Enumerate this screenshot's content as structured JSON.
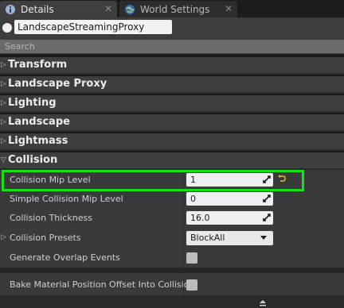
{
  "tabs": [
    {
      "label": "Details",
      "icon": "details-icon",
      "active": true
    },
    {
      "label": "World Settings",
      "icon": "globe-icon",
      "active": false
    }
  ],
  "actor": {
    "name": "LandscapeStreamingProxy"
  },
  "search": {
    "placeholder": "Search"
  },
  "categories": [
    {
      "label": "Transform",
      "expanded": false
    },
    {
      "label": "Landscape Proxy",
      "expanded": false
    },
    {
      "label": "Lighting",
      "expanded": false
    },
    {
      "label": "Landscape",
      "expanded": false
    },
    {
      "label": "Lightmass",
      "expanded": false
    },
    {
      "label": "Collision",
      "expanded": true
    }
  ],
  "collision": {
    "mip_level": {
      "label": "Collision Mip Level",
      "value": "1"
    },
    "simple_mip_level": {
      "label": "Simple Collision Mip Level",
      "value": "0"
    },
    "thickness": {
      "label": "Collision Thickness",
      "value": "16.0"
    },
    "presets": {
      "label": "Collision Presets",
      "value": "BlockAll"
    },
    "overlap": {
      "label": "Generate Overlap Events",
      "checked": false
    },
    "bake": {
      "label": "Bake Material Position Offset Into Collision",
      "checked": false
    }
  },
  "colors": {
    "highlight": "#18e01a",
    "reset_icon": "#e0c020"
  }
}
